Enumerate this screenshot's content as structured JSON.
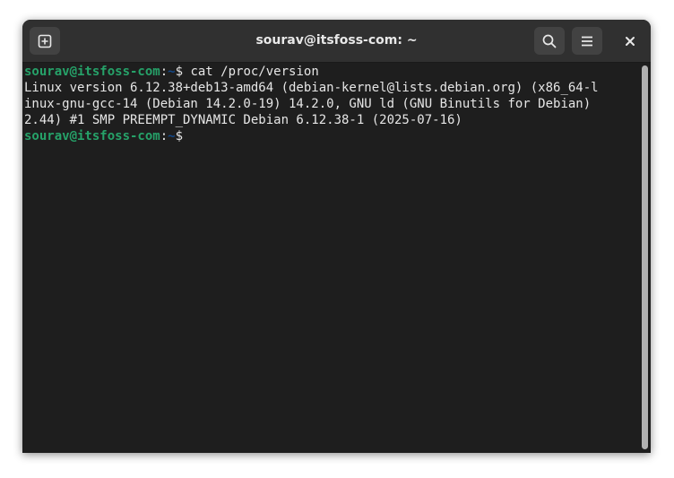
{
  "window": {
    "title": "sourav@itsfoss-com: ~"
  },
  "toolbar": {
    "new_tab_icon": "new-tab-icon",
    "search_icon": "search-icon",
    "menu_icon": "hamburger-menu-icon",
    "close_icon": "close-icon",
    "close_glyph": "✕"
  },
  "terminal": {
    "prompt1": {
      "user": "sourav@itsfoss-com",
      "sep": ":",
      "path": "~",
      "symbol": "$ ",
      "command": "cat /proc/version"
    },
    "output": [
      "Linux version 6.12.38+deb13-amd64 (debian-kernel@lists.debian.org) (x86_64-l",
      "inux-gnu-gcc-14 (Debian 14.2.0-19) 14.2.0, GNU ld (GNU Binutils for Debian)",
      "2.44) #1 SMP PREEMPT_DYNAMIC Debian 6.12.38-1 (2025-07-16)"
    ],
    "prompt2": {
      "user": "sourav@itsfoss-com",
      "sep": ":",
      "path": "~",
      "symbol": "$"
    }
  },
  "colors": {
    "user": "#26a269",
    "path": "#12488b",
    "background": "#1e1e1e",
    "titlebar": "#303030"
  }
}
